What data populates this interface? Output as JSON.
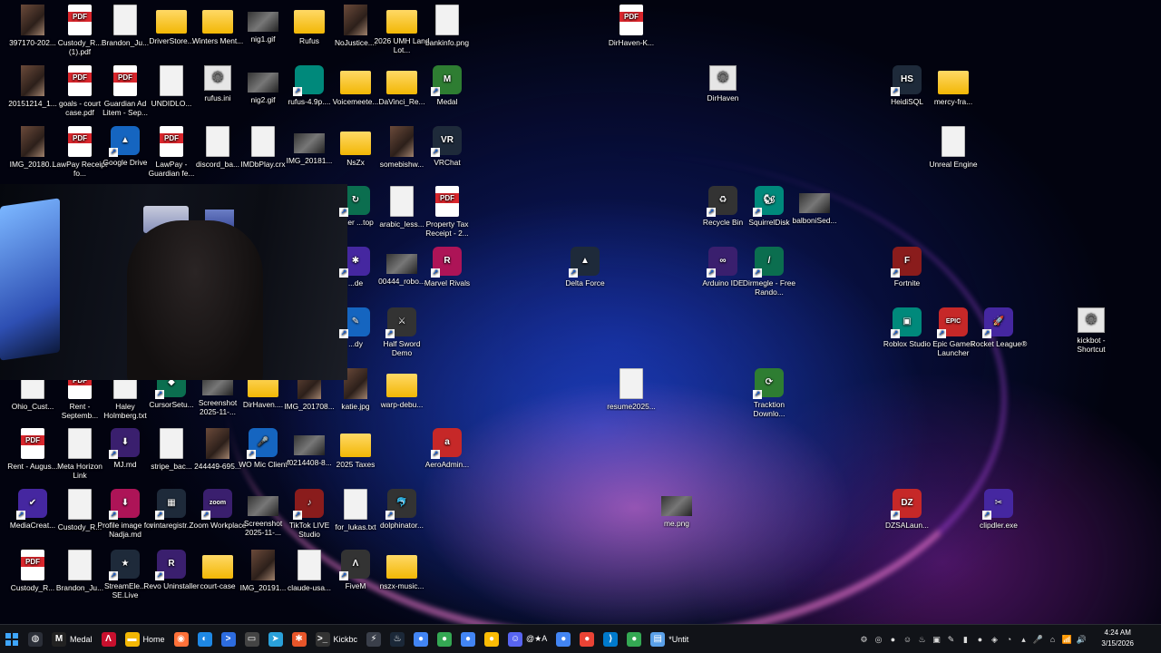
{
  "desktop": {
    "icons": [
      {
        "label": "397170-202...",
        "type": "img"
      },
      {
        "label": "Custody_R... (1).pdf",
        "type": "pdf"
      },
      {
        "label": "Brandon_Ju...",
        "type": "doc"
      },
      {
        "label": "DriverStore...",
        "type": "folder"
      },
      {
        "label": "Winters Ment...",
        "type": "folder"
      },
      {
        "label": "nig1.gif",
        "type": "img2"
      },
      {
        "label": "Rufus",
        "type": "folder"
      },
      {
        "label": "NoJustice....",
        "type": "img"
      },
      {
        "label": "2026 UMH Land Lot...",
        "type": "folder"
      },
      {
        "label": "bankinfo.png",
        "type": "doc"
      },
      {
        "label": "DirHaven-K...",
        "type": "pdf"
      },
      {
        "label": "20151214_1...",
        "type": "img"
      },
      {
        "label": "goals - court case.pdf",
        "type": "pdf"
      },
      {
        "label": "Guardian Ad Litem - Sep...",
        "type": "pdf"
      },
      {
        "label": "UNDIDLO...",
        "type": "doc"
      },
      {
        "label": "rufus.ini",
        "type": "gear"
      },
      {
        "label": "nig2.gif",
        "type": "img2"
      },
      {
        "label": "rufus-4.9p....",
        "type": "app"
      },
      {
        "label": "Voicemeete...",
        "type": "folder"
      },
      {
        "label": "DaVinci_Re...",
        "type": "folder"
      },
      {
        "label": "Medal",
        "type": "app",
        "icon": "M"
      },
      {
        "label": "DirHaven",
        "type": "gear"
      },
      {
        "label": "HeidiSQL",
        "type": "app",
        "icon": "HS"
      },
      {
        "label": "mercy-fra...",
        "type": "folder"
      },
      {
        "label": "IMG_20180...",
        "type": "img"
      },
      {
        "label": "LawPay Receipt fo...",
        "type": "pdf"
      },
      {
        "label": "Google Drive",
        "type": "app",
        "icon": "▲"
      },
      {
        "label": "LawPay - Guardian fe...",
        "type": "pdf"
      },
      {
        "label": "discord_ba...",
        "type": "doc"
      },
      {
        "label": "IMDbPlay.crx",
        "type": "doc"
      },
      {
        "label": "IMG_20181...",
        "type": "img2"
      },
      {
        "label": "NsZx",
        "type": "folder"
      },
      {
        "label": "somebishw...",
        "type": "img"
      },
      {
        "label": "VRChat",
        "type": "app",
        "icon": "VR"
      },
      {
        "label": "Unreal Engine",
        "type": "doc"
      },
      {
        "label": "...ker ...top",
        "type": "app",
        "icon": "↻"
      },
      {
        "label": "arabic_less...",
        "type": "doc"
      },
      {
        "label": "Property Tax Receipt - 2...",
        "type": "pdf"
      },
      {
        "label": "Recycle Bin",
        "type": "app",
        "icon": "♻"
      },
      {
        "label": "SquirrelDisk",
        "type": "app",
        "icon": "🐿"
      },
      {
        "label": "balboniSed...",
        "type": "img2"
      },
      {
        "label": "...de",
        "type": "app",
        "icon": "✱"
      },
      {
        "label": "00444_robo...",
        "type": "img2"
      },
      {
        "label": "Marvel Rivals",
        "type": "app",
        "icon": "R"
      },
      {
        "label": "Delta Force",
        "type": "app",
        "icon": "▲"
      },
      {
        "label": "Arduino IDE",
        "type": "app",
        "icon": "∞"
      },
      {
        "label": "Dirmegle - Free Rando...",
        "type": "app",
        "icon": "/"
      },
      {
        "label": "Fortnite",
        "type": "app",
        "icon": "F"
      },
      {
        "label": "...dy",
        "type": "app",
        "icon": "✎"
      },
      {
        "label": "Half Sword Demo",
        "type": "app",
        "icon": "⚔"
      },
      {
        "label": "Roblox Studio",
        "type": "app",
        "icon": "▣"
      },
      {
        "label": "Epic Games Launcher",
        "type": "app",
        "icon": "EPIC"
      },
      {
        "label": "Rocket League®",
        "type": "app",
        "icon": "🚀"
      },
      {
        "label": "kickbot - Shortcut",
        "type": "gear"
      },
      {
        "label": "Ohio_Cust...",
        "type": "doc"
      },
      {
        "label": "Rent - Septemb...",
        "type": "pdf"
      },
      {
        "label": "Haley Holmberg.txt",
        "type": "doc"
      },
      {
        "label": "CursorSetu...",
        "type": "app",
        "icon": "◆"
      },
      {
        "label": "Screenshot 2025-11-...",
        "type": "img2"
      },
      {
        "label": "DirHaven....",
        "type": "folder"
      },
      {
        "label": "IMG_201708...",
        "type": "img"
      },
      {
        "label": "katie.jpg",
        "type": "img"
      },
      {
        "label": "warp-debu...",
        "type": "folder"
      },
      {
        "label": "resume2025...",
        "type": "doc"
      },
      {
        "label": "Tracktion Downlo...",
        "type": "app",
        "icon": "⟳"
      },
      {
        "label": "Rent - Augus...",
        "type": "pdf"
      },
      {
        "label": "Meta Horizon Link",
        "type": "doc"
      },
      {
        "label": "MJ.md",
        "type": "app",
        "icon": "⬇"
      },
      {
        "label": "stripe_bac...",
        "type": "doc"
      },
      {
        "label": "244449-695...",
        "type": "img"
      },
      {
        "label": "WO Mic Client",
        "type": "app",
        "icon": "🎤"
      },
      {
        "label": "f0214408-8...",
        "type": "img2"
      },
      {
        "label": "2025 Taxes",
        "type": "folder"
      },
      {
        "label": "AeroAdmin...",
        "type": "app",
        "icon": "a"
      },
      {
        "label": "MediaCreat...",
        "type": "app",
        "icon": "✔"
      },
      {
        "label": "Custody_R...",
        "type": "doc"
      },
      {
        "label": "Profile image for Nadja.md",
        "type": "app",
        "icon": "⬇"
      },
      {
        "label": "vintaregistr...",
        "type": "app",
        "icon": "▦"
      },
      {
        "label": "Zoom Workplace",
        "type": "app",
        "icon": "zoom"
      },
      {
        "label": "Screenshot 2025-11-...",
        "type": "img2"
      },
      {
        "label": "TikTok LIVE Studio",
        "type": "app",
        "icon": "♪"
      },
      {
        "label": "for_lukas.txt",
        "type": "doc"
      },
      {
        "label": "dolphinator...",
        "type": "app",
        "icon": "🐬"
      },
      {
        "label": "me.png",
        "type": "img2"
      },
      {
        "label": "DZSALaun...",
        "type": "app",
        "icon": "DZ"
      },
      {
        "label": "clipdler.exe",
        "type": "app",
        "icon": "✂"
      },
      {
        "label": "Custody_R...",
        "type": "pdf"
      },
      {
        "label": "Brandon_Ju...",
        "type": "doc"
      },
      {
        "label": "StreamEle... SE.Live",
        "type": "app",
        "icon": "★"
      },
      {
        "label": "Revo Uninstaller",
        "type": "app",
        "icon": "R"
      },
      {
        "label": "court-case",
        "type": "folder"
      },
      {
        "label": "IMG_20191...",
        "type": "img"
      },
      {
        "label": "claude-usa...",
        "type": "doc"
      },
      {
        "label": "FiveM",
        "type": "app",
        "icon": "Λ"
      },
      {
        "label": "nszx-music...",
        "type": "folder"
      }
    ]
  },
  "taskbar": {
    "start_icon": "windows-start-icon",
    "apps": [
      {
        "label": "",
        "icon": "◍",
        "color": "#2b2f38"
      },
      {
        "label": "Medal",
        "icon": "M",
        "color": "#222"
      },
      {
        "label": "",
        "icon": "Λ",
        "color": "#c8102e"
      },
      {
        "label": "Home",
        "icon": "▬",
        "color": "#f2b705"
      },
      {
        "label": "",
        "icon": "◉",
        "color": "#ff7139"
      },
      {
        "label": "",
        "icon": "◐",
        "color": "#1e88e5"
      },
      {
        "label": "",
        "icon": ">",
        "color": "#2d6cdf"
      },
      {
        "label": "",
        "icon": "▭",
        "color": "#444"
      },
      {
        "label": "",
        "icon": "➤",
        "color": "#2aa1da"
      },
      {
        "label": "",
        "icon": "✱",
        "color": "#e8562a"
      },
      {
        "label": "Kickbc",
        "icon": ">_",
        "color": "#333"
      },
      {
        "label": "",
        "icon": "⚡",
        "color": "#3a3f4a"
      },
      {
        "label": "",
        "icon": "♨",
        "color": "#1b2838"
      },
      {
        "label": "",
        "icon": "●",
        "color": "#4285f4"
      },
      {
        "label": "",
        "icon": "●",
        "color": "#34a853"
      },
      {
        "label": "",
        "icon": "●",
        "color": "#4285f4"
      },
      {
        "label": "",
        "icon": "●",
        "color": "#fbbc05"
      },
      {
        "label": "@★A",
        "icon": "☺",
        "color": "#5865f2"
      },
      {
        "label": "",
        "icon": "●",
        "color": "#4285f4"
      },
      {
        "label": "",
        "icon": "●",
        "color": "#ea4335"
      },
      {
        "label": "",
        "icon": "⟩",
        "color": "#007acc"
      },
      {
        "label": "",
        "icon": "●",
        "color": "#34a853"
      },
      {
        "label": "*Untit",
        "icon": "▤",
        "color": "#5aa0e8"
      }
    ],
    "tray": [
      "⚙",
      "◎",
      "●",
      "☺",
      "♨",
      "▣",
      "✎",
      "▮",
      "●",
      "◈",
      "◔",
      "▴",
      "🎤",
      "⌂",
      "📶",
      "🔊"
    ],
    "time": "4:24 AM",
    "date": "3/15/2026"
  },
  "colors": {
    "taskbar_bg": "#111318",
    "pdf_red": "#d9262c",
    "folder_yellow": "#f2b705"
  }
}
